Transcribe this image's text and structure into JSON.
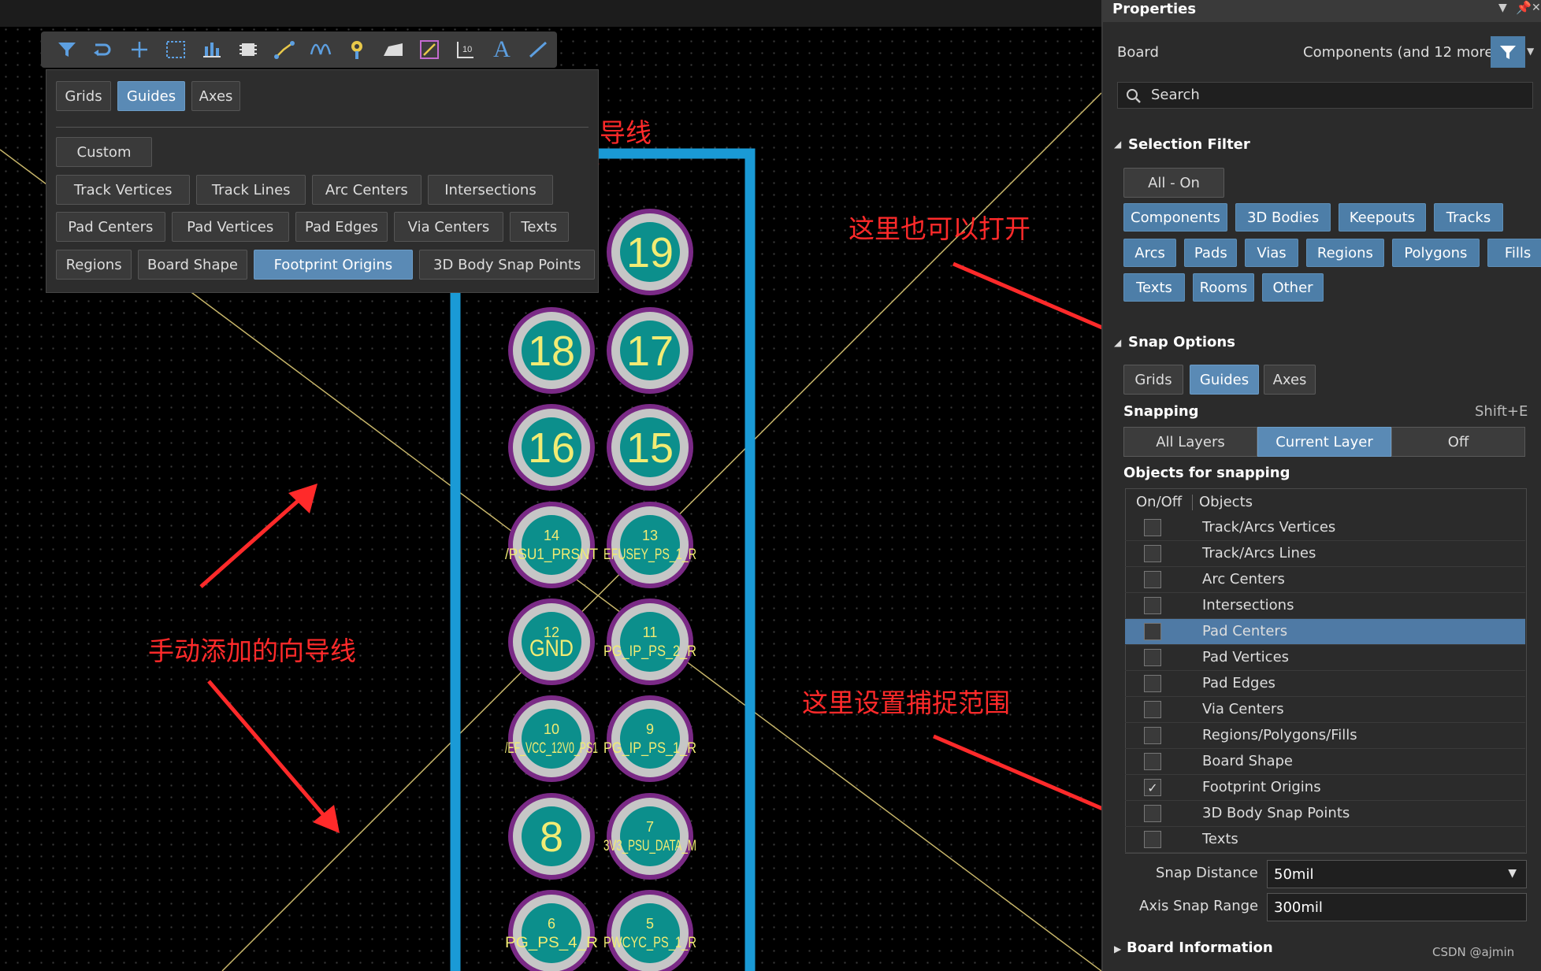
{
  "toolbar": {
    "icons": [
      "filter-icon",
      "route-icon",
      "plus-icon",
      "select-rect-icon",
      "bar-chart-icon",
      "chip-icon",
      "interactive-route-icon",
      "diff-pair-icon",
      "via-pin-icon",
      "polygon-icon",
      "dimension-icon",
      "pad-icon",
      "text-icon",
      "line-icon"
    ],
    "text_icon_glyph": "A"
  },
  "snap_popup": {
    "tabs": [
      {
        "label": "Grids",
        "active": false
      },
      {
        "label": "Guides",
        "active": true
      },
      {
        "label": "Axes",
        "active": false
      }
    ],
    "custom_label": "Custom",
    "rows": [
      [
        {
          "label": "Track Vertices",
          "active": false
        },
        {
          "label": "Track Lines",
          "active": false
        },
        {
          "label": "Arc Centers",
          "active": false
        },
        {
          "label": "Intersections",
          "active": false
        }
      ],
      [
        {
          "label": "Pad Centers",
          "active": false
        },
        {
          "label": "Pad Vertices",
          "active": false
        },
        {
          "label": "Pad Edges",
          "active": false
        },
        {
          "label": "Via Centers",
          "active": false
        },
        {
          "label": "Texts",
          "active": false
        }
      ],
      [
        {
          "label": "Regions",
          "active": false
        },
        {
          "label": "Board Shape",
          "active": false
        },
        {
          "label": "Footprint Origins",
          "active": true
        },
        {
          "label": "3D Body Snap Points",
          "active": false
        }
      ]
    ]
  },
  "annotations": {
    "open_snap_guides": "打开捕捉向导线",
    "also_open_here": "这里也可以打开",
    "manual_guides": "手动添加的向导线",
    "set_snap_range": "这里设置捕捉范围"
  },
  "pads": [
    {
      "number": "19",
      "net": ""
    },
    {
      "number": "18",
      "net": ""
    },
    {
      "number": "17",
      "net": ""
    },
    {
      "number": "16",
      "net": ""
    },
    {
      "number": "15",
      "net": ""
    },
    {
      "number": "14",
      "net": "/PSU1_PRSNT"
    },
    {
      "number": "13",
      "net": "EFUSEY_PS_1_R"
    },
    {
      "number": "12",
      "net": "GND"
    },
    {
      "number": "11",
      "net": "PG_IP_PS_2_R"
    },
    {
      "number": "10",
      "net": "/EF_VCC_12V0_PS1"
    },
    {
      "number": "9",
      "net": "PG_IP_PS_1_R"
    },
    {
      "number": "8",
      "net": ""
    },
    {
      "number": "7",
      "net": "3V3_PSU_DATA_M"
    },
    {
      "number": "6",
      "net": "PG_PS_4_R"
    },
    {
      "number": "5",
      "net": "PWCYC_PS_1_R"
    }
  ],
  "properties": {
    "title": "Properties",
    "header_icons": [
      "dropdown-icon",
      "pin-icon",
      "close-icon"
    ],
    "board_label": "Board",
    "components_label": "Components (and 12 more)",
    "search_placeholder": "Search",
    "selection_filter": {
      "title": "Selection Filter",
      "all_on": "All - On",
      "rows": [
        [
          "Components",
          "3D Bodies",
          "Keepouts",
          "Tracks"
        ],
        [
          "Arcs",
          "Pads",
          "Vias",
          "Regions",
          "Polygons",
          "Fills"
        ],
        [
          "Texts",
          "Rooms",
          "Other"
        ]
      ]
    },
    "snap_options": {
      "title": "Snap Options",
      "tabs": [
        {
          "label": "Grids",
          "active": false
        },
        {
          "label": "Guides",
          "active": true
        },
        {
          "label": "Axes",
          "active": false
        }
      ],
      "snapping_label": "Snapping",
      "snapping_shortcut": "Shift+E",
      "snapping_modes": [
        {
          "label": "All Layers",
          "active": false
        },
        {
          "label": "Current Layer",
          "active": true
        },
        {
          "label": "Off",
          "active": false
        }
      ],
      "objects_title": "Objects for snapping",
      "col_onoff": "On/Off",
      "col_objects": "Objects",
      "objects": [
        {
          "name": "Track/Arcs Vertices",
          "checked": false,
          "selected": false
        },
        {
          "name": "Track/Arcs Lines",
          "checked": false,
          "selected": false
        },
        {
          "name": "Arc Centers",
          "checked": false,
          "selected": false
        },
        {
          "name": "Intersections",
          "checked": false,
          "selected": false
        },
        {
          "name": "Pad Centers",
          "checked": false,
          "selected": true
        },
        {
          "name": "Pad Vertices",
          "checked": false,
          "selected": false
        },
        {
          "name": "Pad Edges",
          "checked": false,
          "selected": false
        },
        {
          "name": "Via Centers",
          "checked": false,
          "selected": false
        },
        {
          "name": "Regions/Polygons/Fills",
          "checked": false,
          "selected": false
        },
        {
          "name": "Board Shape",
          "checked": false,
          "selected": false
        },
        {
          "name": "Footprint Origins",
          "checked": true,
          "selected": false
        },
        {
          "name": "3D Body Snap Points",
          "checked": false,
          "selected": false
        },
        {
          "name": "Texts",
          "checked": false,
          "selected": false
        }
      ],
      "check_glyph": "✓",
      "snap_distance_label": "Snap Distance",
      "snap_distance_value": "50mil",
      "axis_snap_range_label": "Axis Snap Range",
      "axis_snap_range_value": "300mil"
    },
    "board_information": "Board Information",
    "watermark": "CSDN @ajmin"
  },
  "colors": {
    "accent": "#5a8ab5",
    "filter_button": "#4d7ea8",
    "annotation": "#ff2a2a",
    "board_outline": "#1a9ad6",
    "pad_ring": "#7a2a86",
    "pad_gray": "#c6c6c6",
    "pad_fill": "#0c8f8c",
    "pad_text": "#f1ec74",
    "guide_line": "#c8b66a"
  }
}
